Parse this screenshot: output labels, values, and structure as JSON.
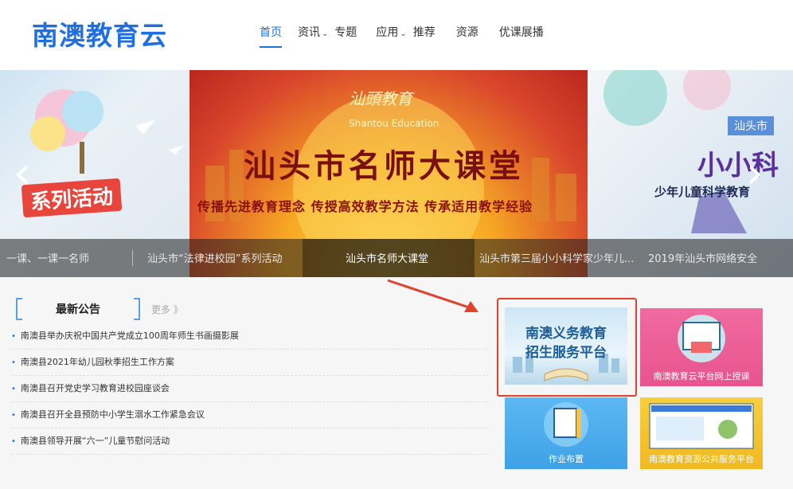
{
  "header": {
    "logo": "南澳教育云",
    "nav": [
      {
        "label": "首页",
        "active": true,
        "has_dropdown": false
      },
      {
        "label": "资讯",
        "active": false,
        "has_dropdown": true
      },
      {
        "label": "专题",
        "active": false,
        "has_dropdown": false
      },
      {
        "label": "应用",
        "active": false,
        "has_dropdown": true
      },
      {
        "label": "推荐",
        "active": false,
        "has_dropdown": false
      },
      {
        "label": "资源",
        "active": false,
        "has_dropdown": false
      },
      {
        "label": "优课展播",
        "active": false,
        "has_dropdown": false
      }
    ]
  },
  "carousel": {
    "left_slide_text": "系列活动",
    "center": {
      "brand_cn": "汕頭教育",
      "brand_en": "Shantou Education",
      "title": "汕头市名师大课堂",
      "subtitle": "传播先进教育理念  传授高效教学方法  传承适用教学经验"
    },
    "right_slide": {
      "chip": "汕头市",
      "title": "小小科",
      "subtitle": "少年儿童科学教育"
    },
    "captions": [
      "一课、一课一名师",
      "汕头市“法律进校园”系列活动",
      "汕头市名师大课堂",
      "汕头市第三届小小科学家少年儿...",
      "2019年汕头市网络安全"
    ],
    "active_caption_index": 2,
    "prev_icon": "chevron-left-icon",
    "next_icon": "chevron-right-icon"
  },
  "notice": {
    "title": "最新公告",
    "more": "更多 》",
    "items": [
      "南澳县举办庆祝中国共产党成立100周年师生书画摄影展",
      "南澳县2021年幼儿园秋季招生工作方案",
      "南澳县召开党史学习教育进校园座谈会",
      "南澳县召开全县预防中小学生溺水工作紧急会议",
      "南澳县领导开展“六一”儿童节慰问活动"
    ]
  },
  "apps": {
    "compulsory": {
      "line1": "南澳义务教育",
      "line2": "招生服务平台"
    },
    "online": "南澳教育云平台网上授课",
    "homework": "作业布置",
    "resource": "南澳教育资源公共服务平台"
  },
  "colors": {
    "brand": "#1f6fe0",
    "highlight": "#e2422c",
    "online_card": "#e8548d",
    "homework_card": "#3ea1e6",
    "resource_card": "#f0b922"
  }
}
